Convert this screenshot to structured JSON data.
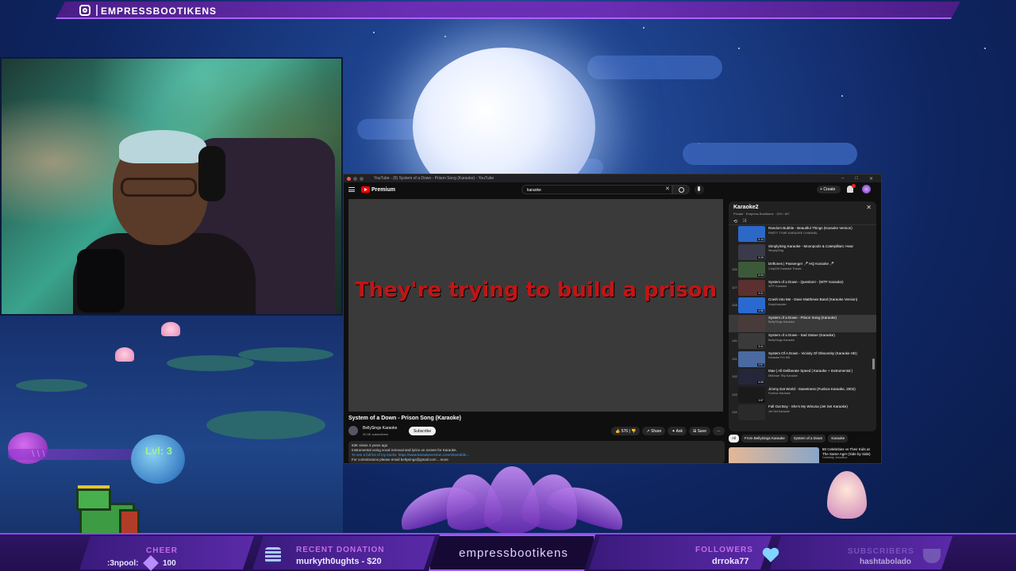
{
  "overlay": {
    "instagram_handle": "EMPRESSBOOTIKENS",
    "level_text": "Lvl: 3",
    "bottom_bar": {
      "cheer_label": "CHEER",
      "cheer_user": ":3npool:",
      "cheer_amount": "100",
      "donation_label": "RECENT DONATION",
      "donation_value": "murkyth0ughts - $20",
      "center_name": "empressbootikens",
      "followers_label": "FOLLOWERS",
      "followers_value": "drroka77",
      "subscribers_label": "SUBSCRIBERS",
      "subscribers_value": "hashtabolado"
    }
  },
  "browser": {
    "tab_title": "YouTube - (6) System of a Down - Prison Song (Karaoke) - YouTube",
    "youtube": {
      "logo_text": "Premium",
      "search_value": "karaoke",
      "create_label": "Create",
      "lyric_line": "They're trying to build a prison",
      "video_title": "System of a Down - Prison Song (Karaoke)",
      "channel_name": "BellySings Karaoke",
      "channel_subs": "20.9K subscribers",
      "subscribe_label": "Subscribe",
      "like_count": "576",
      "share_label": "Share",
      "ask_label": "Ask",
      "save_label": "Save",
      "description": [
        "53K views 4 years ago",
        "Instrumental using vocal removal and lyrics on screen for Karaoke.",
        "To see a full list of my tracks: https://www.karaokeversion.com/shared/de...",
        "For commissions please email bellysings@gmail.com ...more"
      ]
    },
    "playlist": {
      "title": "Karaoke2",
      "meta": "Private · Empress Bootikens · 129 / 187",
      "items": [
        {
          "num": "",
          "title": "Random Bubble - Beautiful Things (Karaoke Version)",
          "channel": "PARTY TYME KARAOKE CHANNEL",
          "duration": "3:14",
          "color": "#2c68c8"
        },
        {
          "num": "",
          "title": "SimplySing Karaoke - Moonpools & Caterpillars: Hear",
          "channel": "SimplySing",
          "duration": "3:29",
          "color": "#3a3a4a"
        },
        {
          "num": "126",
          "title": "Deftones | Passenger 🎤 HQ Karaoke 🎤",
          "channel": "Chip233 Karaoke Tracks",
          "duration": "5:09",
          "color": "#3c5a3a"
        },
        {
          "num": "127",
          "title": "System of a Down - Question! - (WTF Karaoke)",
          "channel": "WTF Karaoke",
          "duration": "3:21",
          "color": "#5a3030"
        },
        {
          "num": "128",
          "title": "Crash Into Me - Dave Matthews Band (Karaoke Version)",
          "channel": "EasyKaraoke",
          "duration": "4:56",
          "color": "#2a6ad0"
        },
        {
          "num": "",
          "title": "System of a Down - Prison Song (Karaoke)",
          "channel": "BellySings Karaoke",
          "duration": "",
          "color": "#4a3b3b"
        },
        {
          "num": "130",
          "title": "System of a Down - Sad Statue (Karaoke)",
          "channel": "BellySings Karaoke",
          "duration": "3:41",
          "color": "#3a3a3a"
        },
        {
          "num": "131",
          "title": "System Of A Down - Vicinity Of Obscenity (Karaoke HD)",
          "channel": "Karaoke Fm HD",
          "duration": "2:57",
          "color": "#4a6aa0"
        },
        {
          "num": "132",
          "title": "Mae | All Deliberate Speed | Karaoke + Instrumental |",
          "channel": "Milkmae Tilly Karaoke",
          "duration": "5:05",
          "color": "#26263a"
        },
        {
          "num": "133",
          "title": "Jimmy Eat World - Sweetness (Funbox Karaoke, 2002)",
          "channel": "Funbox Karaoke",
          "duration": "3:57",
          "color": "#1a1a1a"
        },
        {
          "num": "134",
          "title": "Fall Out Boy - She's My Winona (Jet Set Karaoke)",
          "channel": "Jet Set Karaoke",
          "duration": "",
          "color": "#2a2a2a"
        }
      ]
    },
    "chips": [
      "All",
      "From BellySings Karaoke",
      "System of a Down",
      "Karaoke"
    ],
    "recommendation": {
      "title": "80 Celebrities vs Their Kids at The Same Age! (Side by Side)",
      "channel": "Celebrity JuiceBox"
    }
  }
}
